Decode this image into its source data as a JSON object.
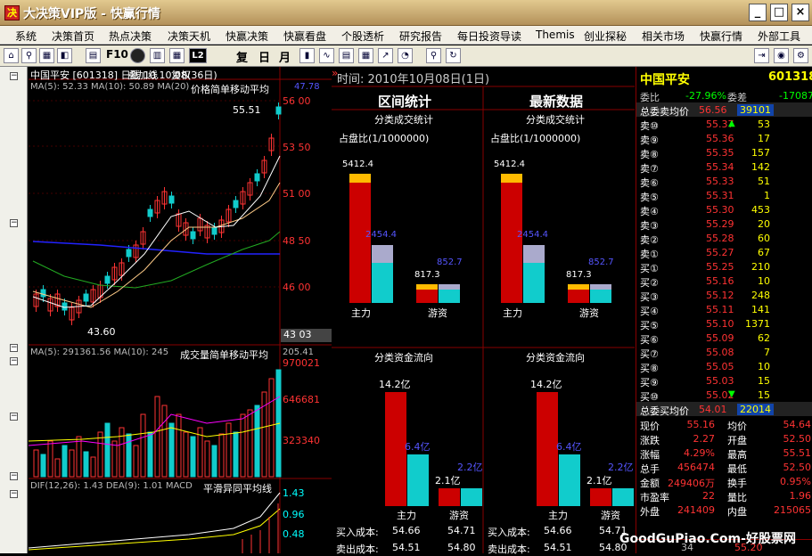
{
  "window": {
    "title": "大决策VIP版 - 快赢行情",
    "logo": "决"
  },
  "menu": [
    "系统",
    "决策首页",
    "热点决策",
    "决策天机",
    "快赢决策",
    "快赢看盘",
    "个股透析",
    "研究报告",
    "每日投资导读",
    "Themis",
    "创业探秘",
    "相关市场",
    "快赢行情",
    "外部工具"
  ],
  "toolbar": {
    "items": [
      "home-icon",
      "search-icon",
      "grid-icon",
      "split-icon",
      "doc-icon"
    ],
    "f10": "F10",
    "more": [
      "circle-icon",
      "calc-icon",
      "grid2-icon"
    ],
    "l2": "L2",
    "periods": [
      "复",
      "日",
      "月"
    ],
    "chart_icons": [
      "bar-icon",
      "line-icon",
      "table-icon",
      "multi-icon",
      "trend-icon",
      "pie-icon",
      "zoom-icon",
      "refresh-icon"
    ],
    "right_icons": [
      "exit-icon",
      "globe-icon",
      "settings-icon"
    ]
  },
  "chart": {
    "header": "中国平安 [601318] 日线 10.10.08(36日)",
    "overlay1": "叠加线",
    "overlay2": "复权",
    "ma_line": "MA(5): 52.33  MA(10): 50.89  MA(20)",
    "ma_label": "价格简单移动平均",
    "ma_right": "47.78",
    "high_label": "55.51",
    "low_label": "43.60",
    "price_axis": [
      "56 00",
      "53 50",
      "51 00",
      "48 50",
      "46 00"
    ],
    "price_bottom": "43 03",
    "vol_line": "MA(5): 291361.56  MA(10): 245",
    "vol_label": "成交量简单移动平均",
    "vol_right": "205.41",
    "vol_axis": [
      "970021",
      "646681",
      "323340"
    ],
    "macd_line": "DIF(12,26): 1.43  DEA(9): 1.01  MACD",
    "macd_label": "平滑异同平均线",
    "macd_axis": [
      "1.43",
      "0.96",
      "0.48"
    ]
  },
  "mid": {
    "time_label": "时间: 2010年10月08日(1日)",
    "left_title": "区间统计",
    "right_title": "最新数据",
    "sec1": "分类成交统计",
    "ratio": "占盘比(1/1000000)",
    "bar_vals": [
      "5412.4",
      "2454.4",
      "817.3",
      "852.7"
    ],
    "cats": [
      "主力",
      "游资"
    ],
    "sec2": "分类资金流向",
    "flow_vals": [
      "14.2亿",
      "6.4亿",
      "2.1亿",
      "2.2亿"
    ],
    "cost": [
      {
        "label": "买入成本:",
        "a": "54.66",
        "b": "54.71"
      },
      {
        "label": "卖出成本:",
        "a": "54.51",
        "b": "54.80"
      }
    ]
  },
  "quote": {
    "name": "中国平安",
    "code": "601318",
    "wb_label": "委比",
    "wb": "-27.96%",
    "wc_label": "委差",
    "wc": "-17087",
    "ask_avg_label": "总委卖均价",
    "ask_avg": "56.56",
    "ask_total": "39101",
    "asks": [
      [
        "卖⑩",
        "55.37",
        "53"
      ],
      [
        "卖⑨",
        "55.36",
        "17"
      ],
      [
        "卖⑧",
        "55.35",
        "157"
      ],
      [
        "卖⑦",
        "55.34",
        "142"
      ],
      [
        "卖⑥",
        "55.33",
        "51"
      ],
      [
        "卖⑤",
        "55.31",
        "1"
      ],
      [
        "卖④",
        "55.30",
        "453"
      ],
      [
        "卖③",
        "55.29",
        "20"
      ],
      [
        "卖②",
        "55.28",
        "60"
      ],
      [
        "卖①",
        "55.27",
        "67"
      ]
    ],
    "bids": [
      [
        "买①",
        "55.25",
        "210"
      ],
      [
        "买②",
        "55.16",
        "10"
      ],
      [
        "买③",
        "55.12",
        "248"
      ],
      [
        "买④",
        "55.11",
        "141"
      ],
      [
        "买⑤",
        "55.10",
        "1371"
      ],
      [
        "买⑥",
        "55.09",
        "62"
      ],
      [
        "买⑦",
        "55.08",
        "7"
      ],
      [
        "买⑧",
        "55.05",
        "10"
      ],
      [
        "买⑨",
        "55.03",
        "15"
      ],
      [
        "买⑩",
        "55.02",
        "15"
      ]
    ],
    "bid_avg_label": "总委买均价",
    "bid_avg": "54.01",
    "bid_total": "22014",
    "stats": [
      [
        "现价",
        "55.16",
        "均价",
        "54.64"
      ],
      [
        "涨跌",
        "2.27",
        "开盘",
        "52.50"
      ],
      [
        "涨幅",
        "4.29%",
        "最高",
        "55.51"
      ],
      [
        "总手",
        "456474",
        "最低",
        "52.50"
      ],
      [
        "金额",
        "249406万",
        "换手",
        "0.95%"
      ],
      [
        "市盈率",
        "22",
        "量比",
        "1.96"
      ],
      [
        "外盘",
        "241409",
        "内盘",
        "215065"
      ]
    ],
    "tick": [
      "34",
      "55.20"
    ]
  },
  "watermark": "GoodGuPiao.Com-好股票网"
}
